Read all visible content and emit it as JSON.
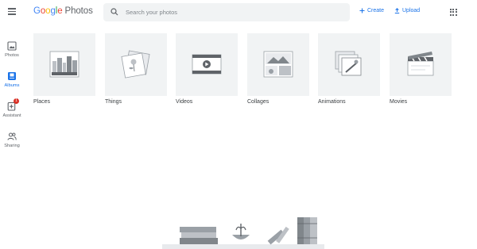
{
  "header": {
    "logo_letters": [
      "G",
      "o",
      "o",
      "g",
      "l",
      "e"
    ],
    "product": "Photos",
    "search_placeholder": "Search your photos",
    "create_label": "Create",
    "upload_label": "Upload"
  },
  "nav": {
    "items": [
      {
        "label": "Photos",
        "icon": "photo-icon"
      },
      {
        "label": "Albums",
        "icon": "album-icon",
        "active": true
      },
      {
        "label": "Assistant",
        "icon": "assistant-icon",
        "badge": "1"
      },
      {
        "label": "Sharing",
        "icon": "people-icon"
      }
    ]
  },
  "categories": [
    {
      "label": "Places",
      "icon": "city-icon"
    },
    {
      "label": "Things",
      "icon": "flower-photo-icon"
    },
    {
      "label": "Videos",
      "icon": "film-icon"
    },
    {
      "label": "Collages",
      "icon": "collage-icon"
    },
    {
      "label": "Animations",
      "icon": "animation-stack-icon"
    },
    {
      "label": "Movies",
      "icon": "clapperboard-icon"
    }
  ],
  "colors": {
    "accent": "#1a73e8",
    "tile_bg": "#f1f3f4",
    "icon_gray": "#5f6368",
    "badge": "#d93025"
  }
}
